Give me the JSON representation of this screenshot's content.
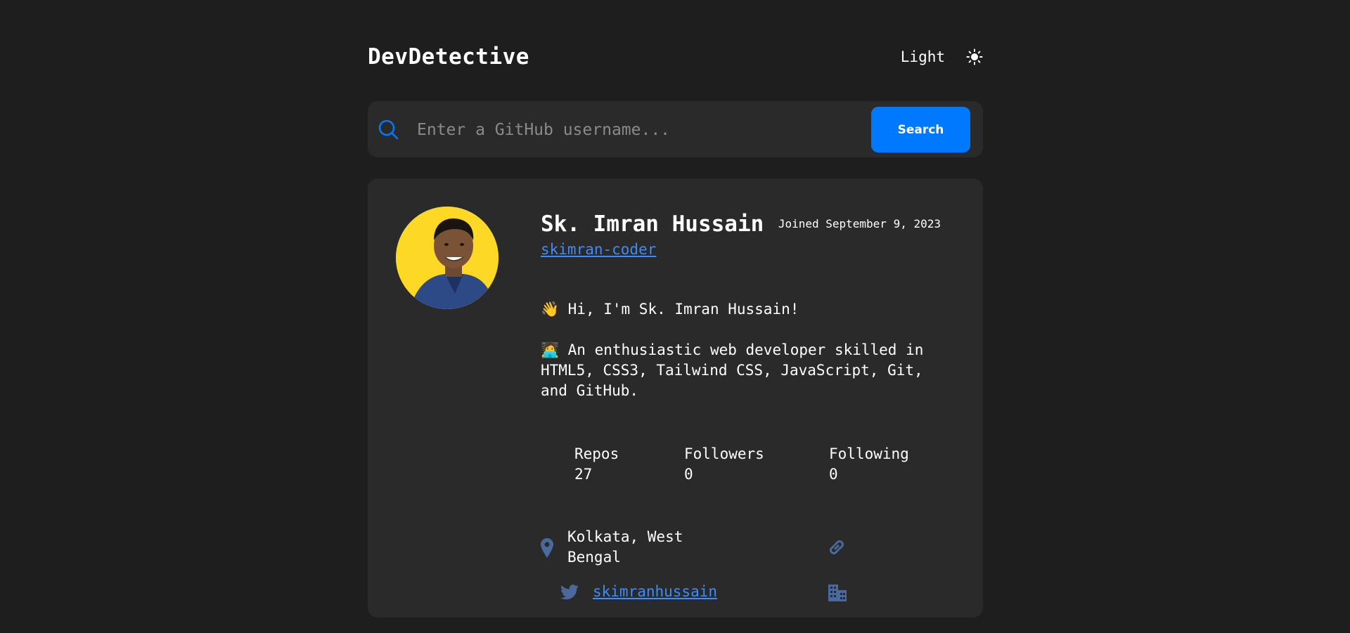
{
  "header": {
    "brand": "DevDetective",
    "theme_label": "Light"
  },
  "search": {
    "placeholder": "Enter a GitHub username...",
    "button_label": "Search"
  },
  "profile": {
    "name": "Sk. Imran Hussain",
    "joined": "Joined September 9, 2023",
    "login": "skimran-coder",
    "bio_line1_emoji": "👋",
    "bio_line1": "Hi, I'm Sk. Imran Hussain!",
    "bio_line2_emoji": "🧑‍💻",
    "bio_line2": "An enthusiastic web developer skilled in HTML5, CSS3, Tailwind CSS, JavaScript, Git, and GitHub.",
    "stats": {
      "repos_label": "Repos",
      "repos_value": "27",
      "followers_label": "Followers",
      "followers_value": "0",
      "following_label": "Following",
      "following_value": "0"
    },
    "location": "Kolkata, West Bengal",
    "twitter": "skimranhussain"
  },
  "colors": {
    "background": "#1e1e1e",
    "card": "#2a2a2a",
    "accent": "#0079ff",
    "link": "#3b8cff",
    "icon_muted": "#4a6a9e"
  },
  "icons": [
    "sun-icon",
    "search-icon",
    "location-pin-icon",
    "link-icon",
    "twitter-icon",
    "building-icon"
  ]
}
